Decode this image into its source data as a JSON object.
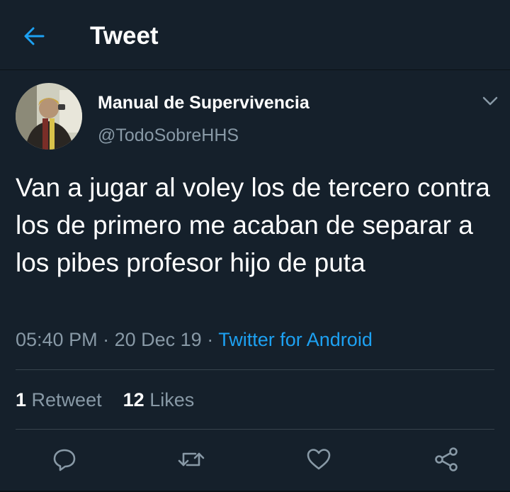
{
  "header": {
    "title": "Tweet",
    "back_icon": "back-arrow-icon"
  },
  "tweet": {
    "author_name": "Manual de Supervivencia",
    "author_handle": "@TodoSobreHHS",
    "text": "Van a jugar al voley los de tercero contra los de primero me acaban de separar a los pibes profesor hijo de puta",
    "time": "05:40 PM",
    "date": "20 Dec 19",
    "separator": "·",
    "source": "Twitter for Android",
    "retweet_count": "1",
    "retweet_label": "Retweet",
    "like_count": "12",
    "like_label": "Likes"
  },
  "actions": [
    "reply-icon",
    "retweet-icon",
    "like-icon",
    "share-icon"
  ],
  "colors": {
    "background": "#15202b",
    "accent": "#1da1f2",
    "secondary_text": "#8899a6",
    "divider": "#38444d"
  }
}
